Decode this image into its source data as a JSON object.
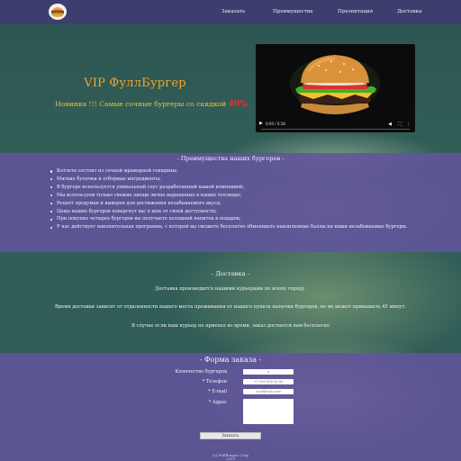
{
  "nav": {
    "links": [
      "Заказать",
      "Преимущества",
      "Презентация",
      "Доставка"
    ]
  },
  "hero": {
    "title": "VIP ФуллБургер",
    "subtitle": "Новинка !!! Самые сочные бургеры со скидкой",
    "discount": "40%"
  },
  "video": {
    "time": "0:00 / 0:18"
  },
  "advantages": {
    "title": "- Преимущества наших бургеров -",
    "items": [
      "Котлета состоит из сочной мраморной говядины;",
      "Мягкие булочки и отборные ингредиенты;",
      "В бургере используется уникальный соус разработанный нашей компанией;",
      "Мы используем только свежие овощи лично выращеные в наших теплицах;",
      "Рецепт продуман и выверен для достижения незабываемого вкуса;",
      "Цены наших бургеров повергнут вас в шок от своей доступности;",
      "При покупке четырех бургеров вы получаете холодный напиток в подарок;",
      "У нас действует накопительная программа, с которой вы сможете бесплатно обменивать накопленные баллы на наши незабываемые бургеры."
    ]
  },
  "delivery": {
    "title": "- Доставка -",
    "p1": "Доставка производится нашими курьерами по всему городу.",
    "p2": "Время доставки зависит от отдаленности вашего места проживания от нашего пункта выпечки бургеров, но не может привышать 45 минут.",
    "p3": "В случае если наш курьер не приехал во время, заказ достается вам бесплатно"
  },
  "form": {
    "title": "- Форма заказа -",
    "quantity_label": "Количество бургеров",
    "quantity_value": "4",
    "phone_label": "* Телефон",
    "phone_placeholder": "+7 000 000 00 00",
    "email_label": "* E-mail",
    "email_placeholder": "mail@mail.com",
    "address_label": "* Адрес",
    "submit_label": "Заказать"
  },
  "footer": {
    "line1": "(c) FullBurger Corp",
    "line2": "2019"
  },
  "colors": {
    "nav_bg": "#3c3f6e",
    "band_bg": "#62549c",
    "title_orange": "#f5a623",
    "discount_red": "#ff2a2a"
  }
}
